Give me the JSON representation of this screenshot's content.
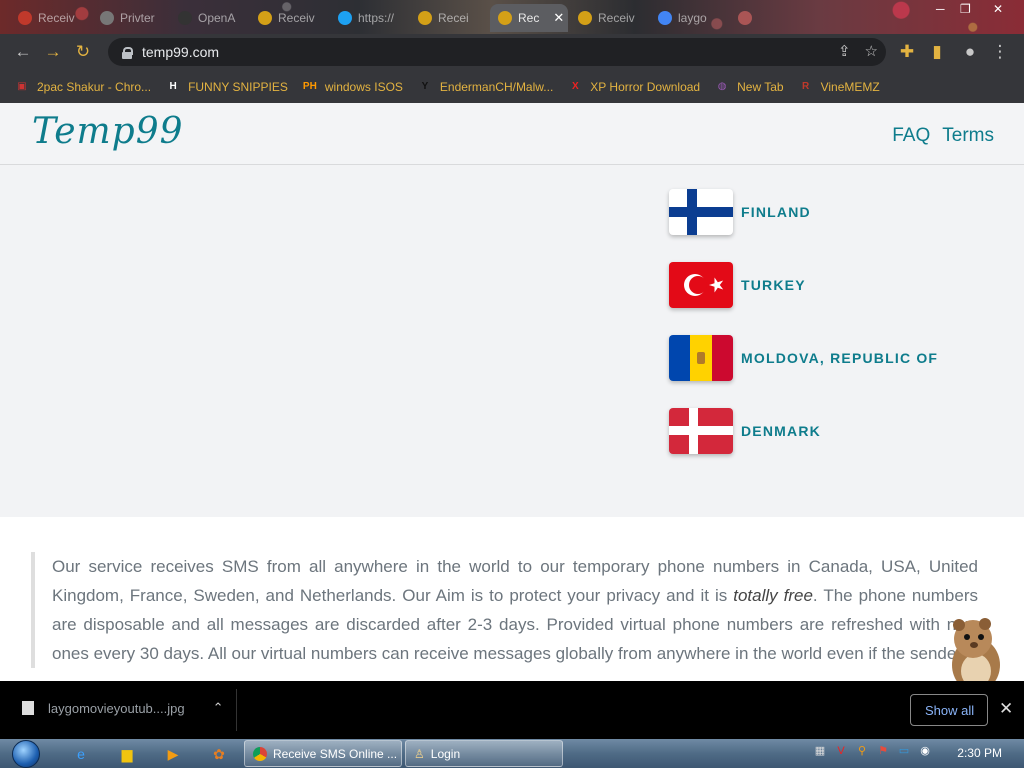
{
  "browser": {
    "tabs": [
      {
        "label": "Receiv",
        "color": "#c0392b"
      },
      {
        "label": "Privter",
        "color": "#777"
      },
      {
        "label": "OpenA",
        "color": "#333"
      },
      {
        "label": "Receiv",
        "color": "#d4a017"
      },
      {
        "label": "https://",
        "color": "#1da1f2"
      },
      {
        "label": "Recei",
        "color": "#d4a017"
      },
      {
        "label": "Rec",
        "color": "#d4a017",
        "active": true
      },
      {
        "label": "Receiv",
        "color": "#d4a017"
      },
      {
        "label": "laygo",
        "color": "#4285f4"
      },
      {
        "label": "",
        "color": "#a55"
      }
    ],
    "url": "temp99.com",
    "bookmarks": [
      {
        "label": "2pac Shakur - Chro...",
        "icon": "gift-icon",
        "color": "#c33"
      },
      {
        "label": "FUNNY SNIPPIES",
        "icon": "H",
        "color": "#fff"
      },
      {
        "label": "windows ISOS",
        "icon": "PH",
        "color": "#f90"
      },
      {
        "label": "EndermanCH/Malw...",
        "icon": "Y",
        "color": "#111"
      },
      {
        "label": "XP Horror Download",
        "icon": "X",
        "color": "#e22"
      },
      {
        "label": "New Tab",
        "icon": "globe-icon",
        "color": "#9b59b6"
      },
      {
        "label": "VineMEMZ",
        "icon": "R",
        "color": "#c0392b"
      }
    ]
  },
  "site": {
    "logo": "Temp99",
    "nav": [
      "FAQ",
      "Terms"
    ],
    "countries": [
      {
        "name": "FINLAND",
        "flag": "finland"
      },
      {
        "name": "TURKEY",
        "flag": "turkey"
      },
      {
        "name": "MOLDOVA, REPUBLIC OF",
        "flag": "moldova"
      },
      {
        "name": "DENMARK",
        "flag": "denmark"
      }
    ],
    "description_pre": "Our service receives SMS from all anywhere in the world to our temporary phone numbers in Canada, USA, United Kingdom, France, Sweden, and Netherlands. Our Aim is to protect your privacy and it is ",
    "description_em": "totally free",
    "description_post": ". The phone numbers are disposable and all messages are discarded after 2-3 days. Provided virtual phone numbers are refreshed with new ones every 30 days. All our virtual numbers can receive messages globally from anywhere in the world even if the sender"
  },
  "downloads": {
    "file": "laygomovieyoutub....jpg",
    "show_all": "Show all"
  },
  "taskbar": {
    "buttons": [
      "Receive SMS Online ...",
      "Login"
    ],
    "time": "2:30 PM"
  },
  "colors": {
    "accent": "#0e7c8c",
    "bookmark_text": "#e3b341"
  }
}
